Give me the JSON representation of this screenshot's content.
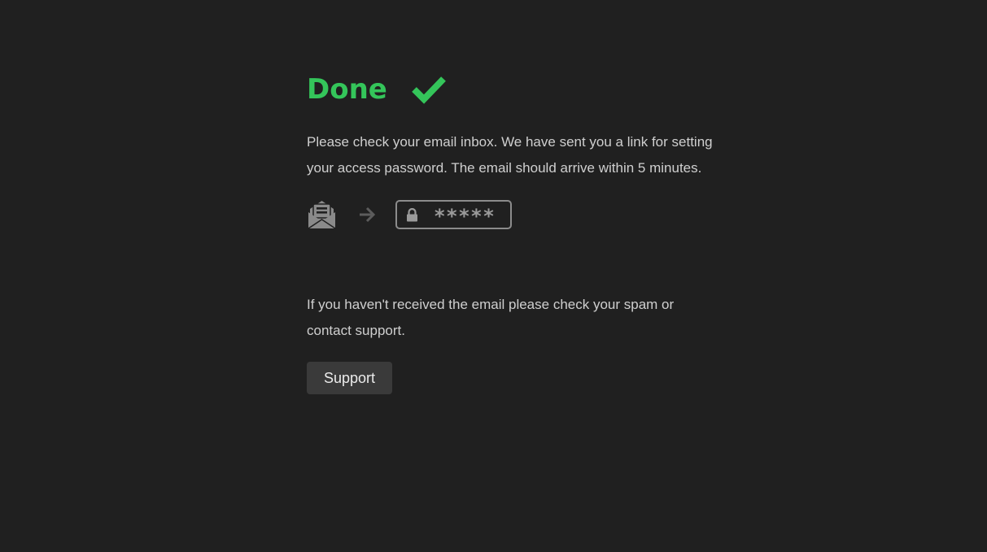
{
  "header": {
    "title": "Done",
    "status_icon": "check-icon",
    "accent_color": "#34c55a"
  },
  "message": {
    "text": "Please check your email inbox. We have sent you a link for setting your access password. The email should arrive within 5 minutes."
  },
  "flow": {
    "email_icon": "open-email-icon",
    "arrow_icon": "arrow-right-icon",
    "lock_icon": "lock-icon",
    "password_mask": "*****"
  },
  "help": {
    "text": "If you haven't received the email please check your spam or contact support."
  },
  "support_button": {
    "label": "Support"
  }
}
